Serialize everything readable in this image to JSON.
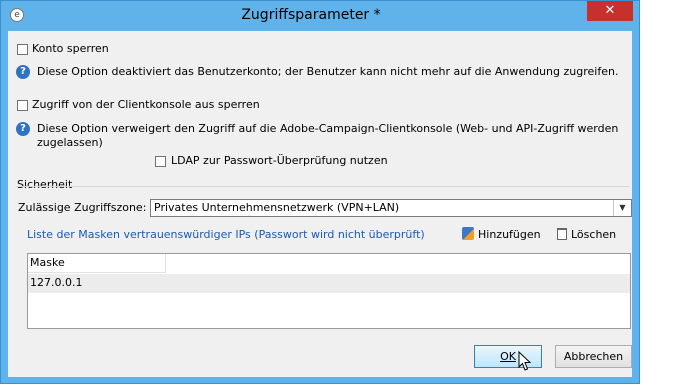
{
  "window": {
    "title": "Zugriffsparameter *",
    "close_glyph": "✕",
    "app_icon_glyph": "e"
  },
  "options": {
    "lock_account_label": "Konto sperren",
    "lock_account_help": "Diese Option deaktiviert das Benutzerkonto; der Benutzer kann nicht mehr auf die Anwendung zugreifen.",
    "block_console_label": "Zugriff von der Clientkonsole aus sperren",
    "block_console_help_line1": "Diese Option verweigert den Zugriff auf die Adobe-Campaign-Clientkonsole (Web- und API-Zugriff werden",
    "block_console_help_line2": "zugelassen)",
    "ldap_label": "LDAP zur Passwort-Überprüfung nutzen",
    "help_glyph": "?"
  },
  "security": {
    "group_label": "Sicherheit",
    "zone_label": "Zulässige Zugriffszone:",
    "zone_value": "Privates Unternehmensnetzwerk (VPN+LAN)",
    "trusted_ips_link": "Liste der Masken vertrauenswürdiger IPs (Passwort wird nicht überprüft)",
    "add_label": "Hinzufügen",
    "delete_label": "Löschen",
    "table": {
      "columns": [
        "Maske"
      ],
      "rows": [
        [
          "127.0.0.1"
        ]
      ]
    }
  },
  "buttons": {
    "ok_label": "OK",
    "cancel_label": "Abbrechen"
  },
  "colors": {
    "title_bar": "#5fb3ea",
    "close_button": "#c7302b",
    "link": "#1a5ab4",
    "help_icon": "#2f72c4"
  }
}
